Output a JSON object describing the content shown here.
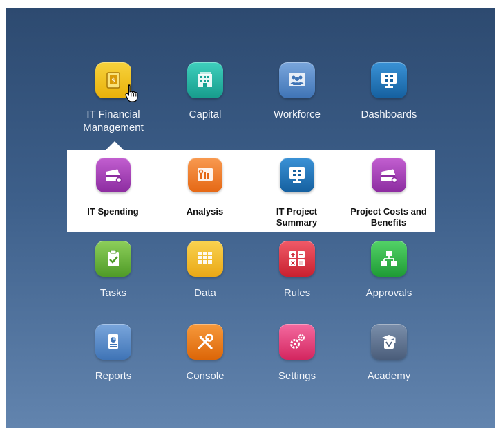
{
  "tiles_row1": [
    {
      "name": "tile-it-financial-management",
      "label": "IT Financial Management",
      "icon": "cash-box-icon",
      "color": "#f2c318"
    },
    {
      "name": "tile-capital",
      "label": "Capital",
      "icon": "building-icon",
      "color": "#27b7a6"
    },
    {
      "name": "tile-workforce",
      "label": "Workforce",
      "icon": "people-icon",
      "color": "#4f86c6"
    },
    {
      "name": "tile-dashboards",
      "label": "Dashboards",
      "icon": "monitor-icon",
      "color": "#1f74b8"
    }
  ],
  "submenu": [
    {
      "name": "submenu-it-spending",
      "label": "IT Spending",
      "icon": "credit-card-icon",
      "color": "#a944b8"
    },
    {
      "name": "submenu-analysis",
      "label": "Analysis",
      "icon": "chart-board-icon",
      "color": "#f27b2a"
    },
    {
      "name": "submenu-it-project-summary",
      "label": "IT Project Summary",
      "icon": "monitor-icon",
      "color": "#1f74b8"
    },
    {
      "name": "submenu-project-costs-and-benefits",
      "label": "Project Costs and Benefits",
      "icon": "credit-card-icon",
      "color": "#a944b8"
    }
  ],
  "tiles_row3": [
    {
      "name": "tile-tasks",
      "label": "Tasks",
      "icon": "clipboard-check-icon",
      "color": "#6cb33e"
    },
    {
      "name": "tile-data",
      "label": "Data",
      "icon": "grid-icon",
      "color": "#f5c02e"
    },
    {
      "name": "tile-rules",
      "label": "Rules",
      "icon": "calculator-icon",
      "color": "#e23b4d"
    },
    {
      "name": "tile-approvals",
      "label": "Approvals",
      "icon": "hierarchy-icon",
      "color": "#33b84a"
    }
  ],
  "tiles_row4": [
    {
      "name": "tile-reports",
      "label": "Reports",
      "icon": "report-icon",
      "color": "#4f86c6"
    },
    {
      "name": "tile-console",
      "label": "Console",
      "icon": "tools-icon",
      "color": "#f07d1c"
    },
    {
      "name": "tile-settings",
      "label": "Settings",
      "icon": "gears-icon",
      "color": "#e8437f"
    },
    {
      "name": "tile-academy",
      "label": "Academy",
      "icon": "graduate-icon",
      "color": "#5a6f8c"
    }
  ]
}
